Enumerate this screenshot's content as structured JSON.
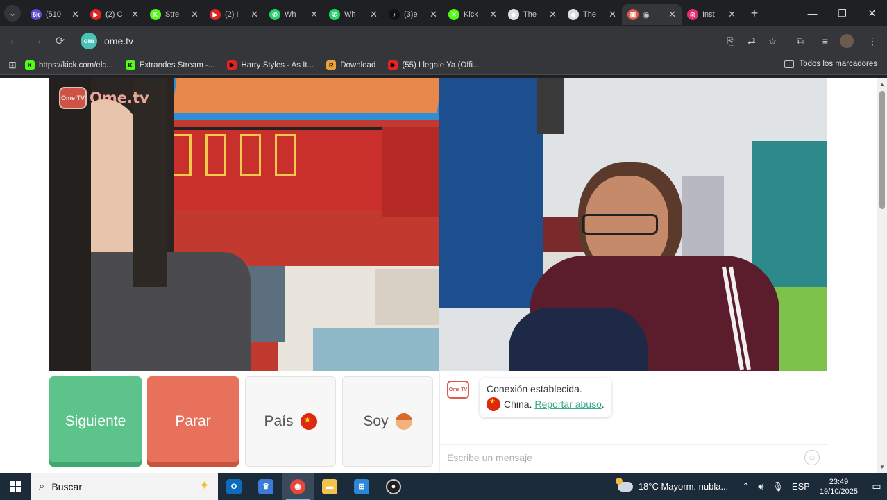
{
  "browser": {
    "tabs": [
      {
        "title": "(510",
        "favicon": "5k",
        "color": "#5d4bd1"
      },
      {
        "title": "(2) C",
        "favicon": "▶",
        "color": "#e02424"
      },
      {
        "title": "Stre",
        "favicon": "K",
        "color": "#53fc18"
      },
      {
        "title": "(2) I",
        "favicon": "▶",
        "color": "#e02424"
      },
      {
        "title": "Wh",
        "favicon": "✆",
        "color": "#25d366"
      },
      {
        "title": "Wh",
        "favicon": "✆",
        "color": "#25d366"
      },
      {
        "title": "(3)e",
        "favicon": "♪",
        "color": "#111111"
      },
      {
        "title": "Kick",
        "favicon": "✕",
        "color": "#53fc18"
      },
      {
        "title": "The",
        "favicon": "◆",
        "color": "#dddddd"
      },
      {
        "title": "The",
        "favicon": "◆",
        "color": "#dddddd"
      },
      {
        "title": "◉",
        "favicon": "▣",
        "color": "#e05a4a",
        "active": true
      },
      {
        "title": "Inst",
        "favicon": "◎",
        "color": "#e1306c"
      }
    ],
    "url": "ome.tv",
    "site_icon": "om",
    "bookmarks": [
      {
        "label": "https://kick.com/elc...",
        "favicon": "K",
        "color": "#53fc18"
      },
      {
        "label": "Extrandes Stream -...",
        "favicon": "K",
        "color": "#53fc18"
      },
      {
        "label": "Harry Styles - As It...",
        "favicon": "▶",
        "color": "#e02424"
      },
      {
        "label": "Download",
        "favicon": "R",
        "color": "#e8a33d"
      },
      {
        "label": "(55) Llegale Ya (Offi...",
        "favicon": "▶",
        "color": "#e02424"
      }
    ],
    "all_bookmarks": "Todos los marcadores"
  },
  "page": {
    "logo_brand": "Ome.tv",
    "logo_box": "Ome TV",
    "buttons": {
      "next": "Siguiente",
      "stop": "Parar",
      "country": "País",
      "gender": "Soy"
    },
    "chat": {
      "logo": "Ome TV",
      "connected": "Conexión establecida.",
      "country": "China.",
      "report": "Reportar abuso",
      "report_suffix": ".",
      "placeholder": "Escribe un mensaje"
    }
  },
  "taskbar": {
    "search_label": "Buscar",
    "weather": "18°C  Mayorm. nubla...",
    "language": "ESP",
    "time": "23:49",
    "date": "19/10/2025"
  }
}
